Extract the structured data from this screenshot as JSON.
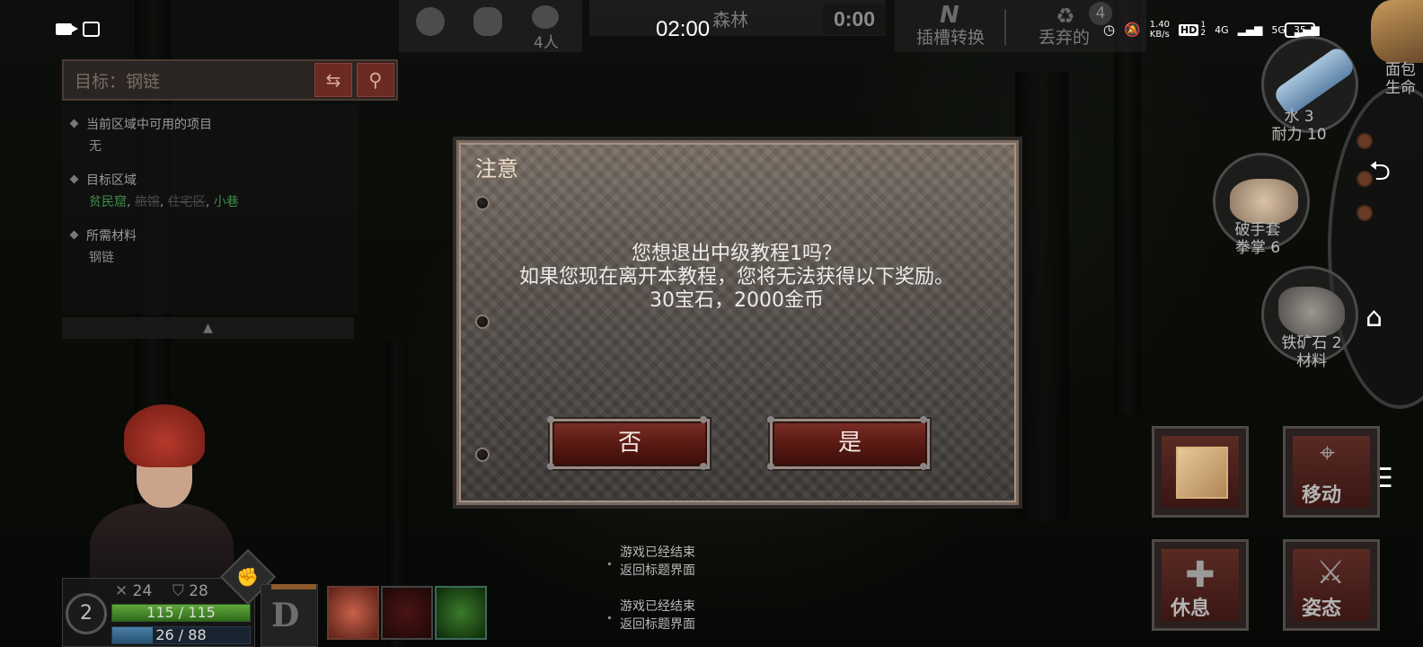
{
  "status_bar": {
    "time": "02:00",
    "net_speed": "1.40\nKB/s",
    "hd": "HD",
    "hd_sub": "1\n2",
    "net_4g": "4G",
    "net_5g": "5G",
    "battery": "35"
  },
  "top_bar": {
    "people_count": "4人",
    "location": "森林",
    "timer": "0:00",
    "slot_letter": "N",
    "slot_swap_label": "插槽转换",
    "discard_label": "丢弃的",
    "discard_count": "4"
  },
  "quest": {
    "target_label": "目标：钢链",
    "available_title": "当前区域中可用的项目",
    "available_value": "无",
    "zone_title": "目标区域",
    "zones": [
      {
        "name": "贫民窟",
        "state": "active"
      },
      {
        "name": "旅馆",
        "state": "inactive"
      },
      {
        "name": "住宅区",
        "state": "inactive"
      },
      {
        "name": "小巷",
        "state": "active"
      }
    ],
    "materials_title": "所需材料",
    "materials_value": "钢链",
    "collapse_arrow": "▲"
  },
  "character": {
    "level": "2",
    "attack": "24",
    "defense": "28",
    "hp_text": "115 / 115",
    "hp_fraction": 1.0,
    "sp_text": "26 / 88",
    "sp_fraction": 0.295,
    "grade": "D"
  },
  "system_messages": [
    {
      "line1": "游戏已经结束",
      "line2": "返回标题界面"
    },
    {
      "line1": "游戏已经结束",
      "line2": "返回标题界面"
    }
  ],
  "items": {
    "water": {
      "line1": "水 3",
      "line2": "耐力 10"
    },
    "gloves": {
      "line1": "破手套",
      "line2": "拳掌 6"
    },
    "ore": {
      "line1": "铁矿石 2",
      "line2": "材料"
    },
    "bread_partial": {
      "line1": "面包",
      "line2": "生命"
    }
  },
  "actions": {
    "move": "移动",
    "rest": "休息",
    "stance": "姿态"
  },
  "dialog": {
    "title": "注意",
    "line1": "您想退出中级教程1吗？",
    "line2": "如果您现在离开本教程，您将无法获得以下奖励。",
    "line3": "30宝石，2000金币",
    "no_label": "否",
    "yes_label": "是"
  },
  "colors": {
    "button_red": "#5a1a14",
    "hp_green": "#5fa83b",
    "sp_blue": "#4a7fa8",
    "zone_active": "#3e8c46"
  },
  "icons": [
    "video-camera-icon",
    "screen-cast-icon",
    "alarm-icon",
    "mute-icon",
    "signal-icon",
    "battery-icon",
    "emoji-icon",
    "chat-icon",
    "people-icon",
    "recycle-icon",
    "swap-icon",
    "search-icon",
    "sword-icon",
    "shield-icon",
    "fist-icon",
    "back-nav-icon",
    "home-nav-icon",
    "menu-nav-icon",
    "map-pin-icon",
    "medical-cross-icon",
    "crossed-swords-icon"
  ]
}
